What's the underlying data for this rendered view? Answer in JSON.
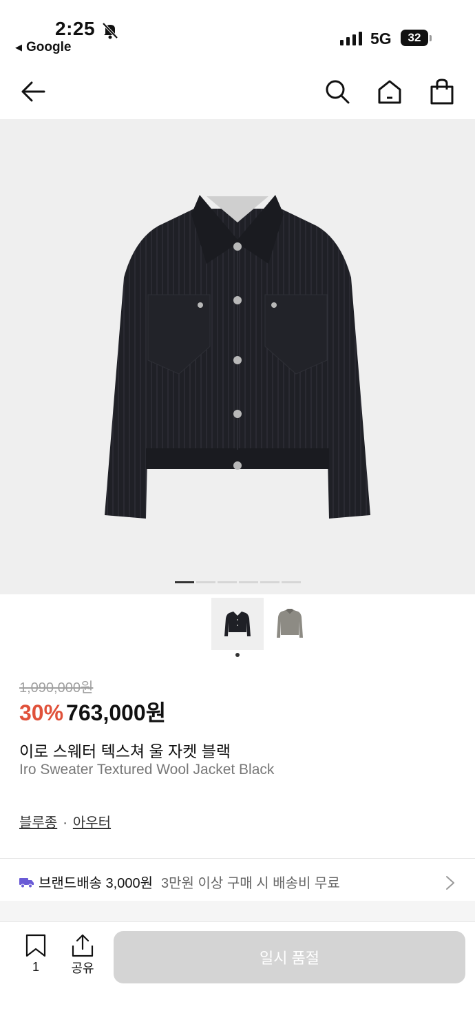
{
  "status_bar": {
    "time": "2:25",
    "back_app": "Google",
    "network": "5G",
    "battery": "32"
  },
  "nav": {
    "icons": [
      "back-arrow-icon",
      "search-icon",
      "home-icon",
      "shopping-bag-icon"
    ]
  },
  "gallery": {
    "image_count": 6,
    "active_index": 0,
    "thumbnails": [
      "black-jacket",
      "gray-jacket"
    ],
    "selected_thumbnail": 0
  },
  "product": {
    "original_price": "1,090,000원",
    "discount": "30%",
    "price": "763,000원",
    "name_ko": "이로 스웨터 텍스쳐 울 자켓 블랙",
    "name_en": "Iro Sweater Textured Wool Jacket Black",
    "category_1": "블루종",
    "category_sep": "·",
    "category_2": "아우터"
  },
  "shipping": {
    "label": "브랜드배송 3,000원",
    "note": "3만원 이상 구매 시 배송비 무료"
  },
  "bottom_bar": {
    "bookmark_count": "1",
    "share_label": "공유",
    "cta_label": "일시 품절"
  },
  "colors": {
    "discount": "#e0513a",
    "cta_disabled": "#d4d4d4",
    "shipping_icon": "#6a5bd6",
    "image_bg": "#efefef"
  }
}
